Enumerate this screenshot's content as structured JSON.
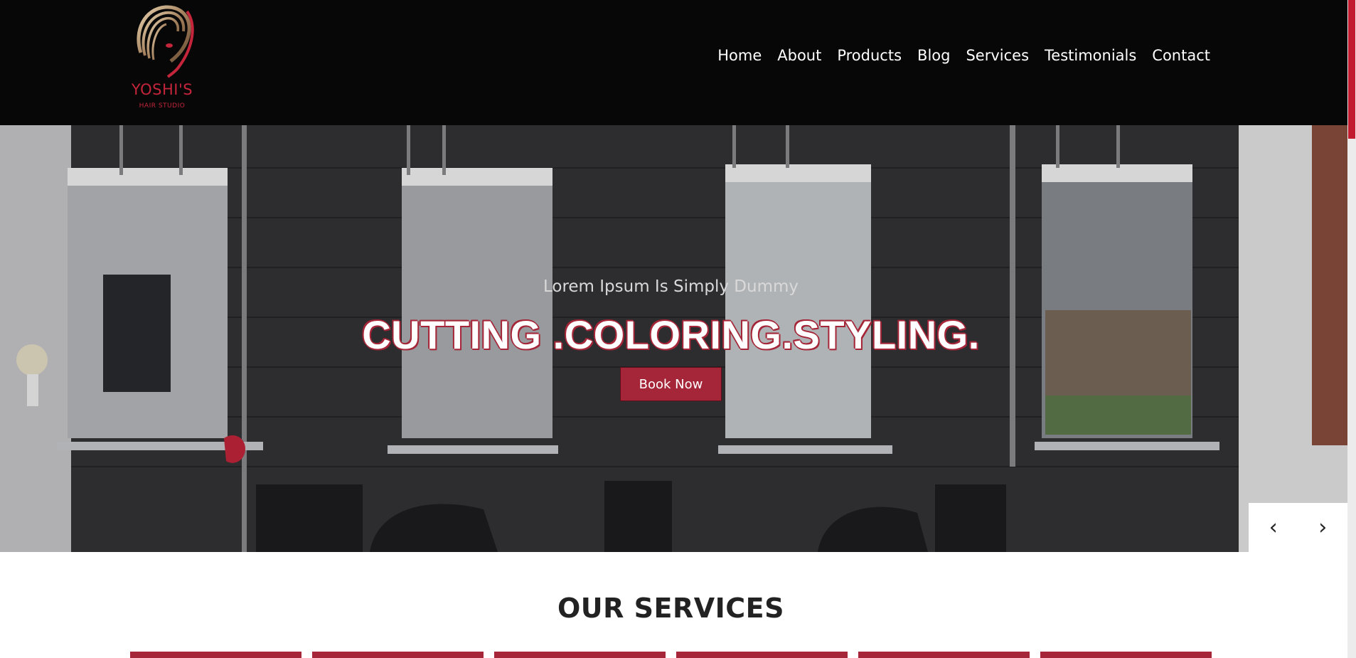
{
  "brand": {
    "name": "YOSHI'S",
    "tagline": "HAIR STUDIO"
  },
  "nav": {
    "items": [
      "Home",
      "About",
      "Products",
      "Blog",
      "Services",
      "Testimonials",
      "Contact"
    ]
  },
  "hero": {
    "subtitle": "Lorem Ipsum Is Simply Dummy",
    "title": "CUTTING .COLORING.STYLING.",
    "cta_label": "Book Now",
    "prev_icon": "‹",
    "next_icon": "›"
  },
  "services": {
    "heading": "OUR SERVICES",
    "card_count": 6
  },
  "colors": {
    "accent": "#a52638",
    "header_bg": "#070707"
  }
}
